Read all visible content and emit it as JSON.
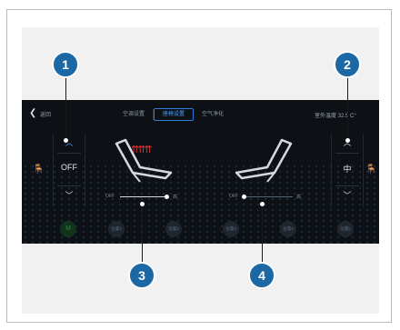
{
  "topbar": {
    "back_label": "返回",
    "tabs": [
      {
        "label": "空调设置",
        "active": false
      },
      {
        "label": "座椅设置",
        "active": true
      },
      {
        "label": "空气净化",
        "active": false
      }
    ],
    "outdoor_temp": "室外温度 32.5 C°"
  },
  "left_panel": {
    "value": "OFF"
  },
  "right_panel": {
    "value": "中"
  },
  "sliders": {
    "left": {
      "min_label": "OFF",
      "max_label": "高",
      "level": 0.95
    },
    "right": {
      "min_label": "OFF",
      "max_label": "高",
      "level": 0.0
    }
  },
  "presets": [
    {
      "label": "M"
    },
    {
      "label": "位置1"
    },
    {
      "label": "位置2"
    },
    {
      "label": "位置3"
    },
    {
      "label": "位置4"
    },
    {
      "label": "位置5"
    },
    {
      "label": "位置6"
    }
  ],
  "callouts": [
    "1",
    "2",
    "3",
    "4"
  ],
  "colors": {
    "accent": "#4aa3ff",
    "callout": "#1c68a4",
    "heat": "#e0322f",
    "screen_bg": "#0d1116"
  }
}
